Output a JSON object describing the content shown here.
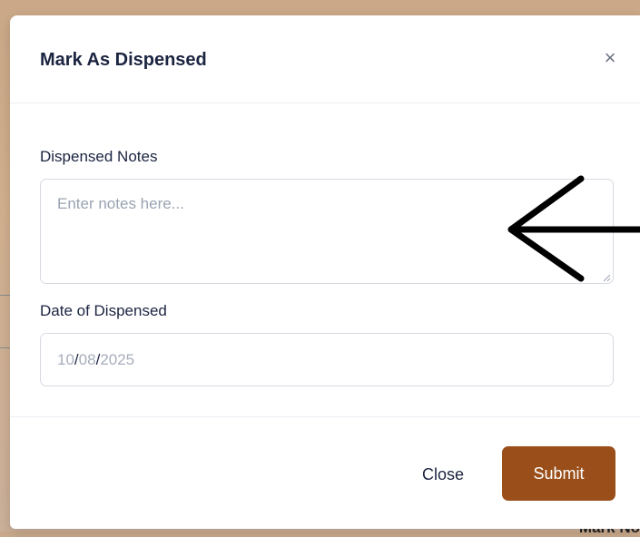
{
  "modal": {
    "title": "Mark As Dispensed",
    "close_icon_glyph": "×"
  },
  "form": {
    "notes_label": "Dispensed Notes",
    "notes_placeholder": "Enter notes here...",
    "notes_value": "",
    "date_label": "Date of Dispensed",
    "date": {
      "month": "10",
      "day": "08",
      "year": "2025",
      "separator": "/"
    }
  },
  "footer": {
    "close_label": "Close",
    "submit_label": "Submit"
  },
  "background": {
    "partial_text": "Mark No"
  },
  "colors": {
    "accent": "#9a4f1a",
    "backdrop": "#c9a98a",
    "annotation_arrow": "#000000"
  },
  "annotation": {
    "type": "arrow",
    "direction": "left",
    "icon": "arrow-left-icon"
  }
}
